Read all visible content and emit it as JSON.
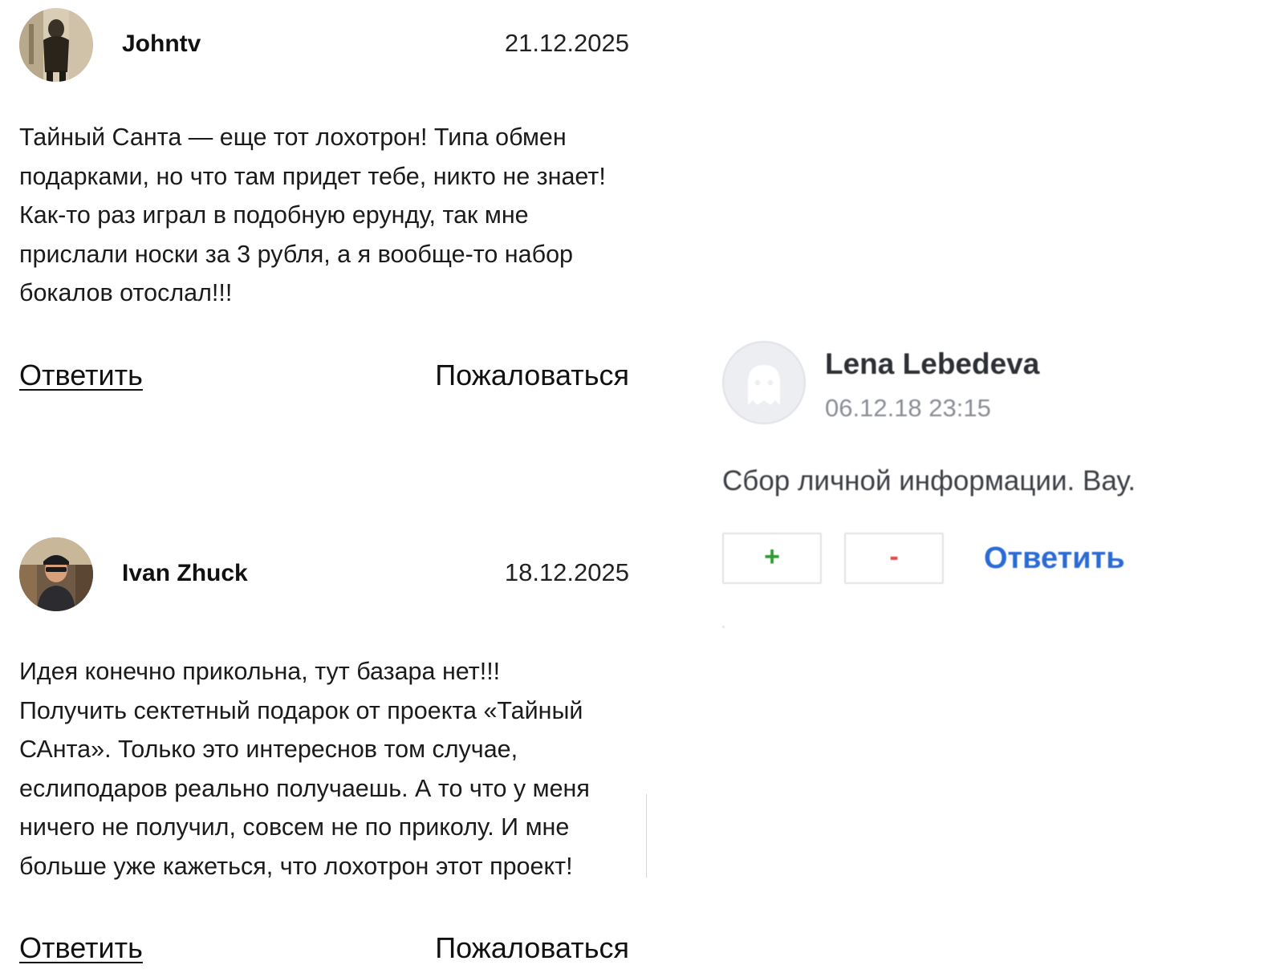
{
  "comments": [
    {
      "author": "Johntv",
      "date": "21.12.2025",
      "text": "Тайный Санта — еще тот лохотрон! Типа обмен подарками, но что там придет тебе, никто не знает! Как-то раз играл в подобную ерунду, так мне прислали носки за 3 рубля, а я вообще-то набор бокалов отослал!!!",
      "reply_label": "Ответить",
      "report_label": "Пожаловаться"
    },
    {
      "author": "Ivan Zhuck",
      "date": "18.12.2025",
      "text": "Идея конечно прикольна, тут базара нет!!! Получить сектетный подарок от проекта «Тайный САнта». Только это интереснов том случае, еслиподаров реально получаешь. А то что у меня ничего не получил, совсем не по приколу. И мне больше уже кажеться, что лохотрон этот проект!",
      "reply_label": "Ответить",
      "report_label": "Пожаловаться"
    }
  ],
  "side_card": {
    "author": "Lena Lebedeva",
    "timestamp": "06.12.18 23:15",
    "text": "Сбор личной информации. Вау.",
    "upvote_label": "+",
    "downvote_label": "-",
    "reply_label": "Ответить",
    "avatar_icon": "ghost-icon"
  },
  "colors": {
    "upvote": "#2e9a33",
    "downvote": "#e04a4a",
    "reply_accent": "#2b6bd6"
  }
}
